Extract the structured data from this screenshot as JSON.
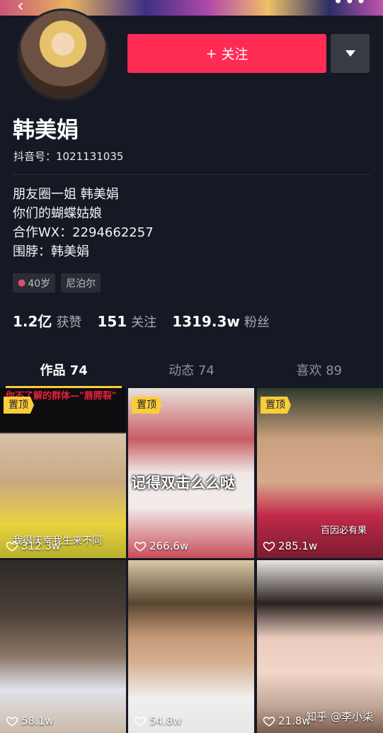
{
  "profile": {
    "name": "韩美娟",
    "douyin_id": "抖音号：1021131035",
    "follow_label": "关注",
    "bio": [
      "朋友圈一姐 韩美娟",
      "你们的蝴蝶姑娘",
      "合作WX：2294662257",
      "围脖：韩美娟"
    ],
    "tags": [
      {
        "icon": "person-icon",
        "text": "40岁"
      },
      {
        "text": "尼泊尔"
      }
    ],
    "stats": [
      {
        "num": "1.2亿",
        "label": "获赞"
      },
      {
        "num": "151",
        "label": "关注"
      },
      {
        "num": "1319.3w",
        "label": "粉丝"
      }
    ]
  },
  "tabs": [
    {
      "label": "作品 74",
      "active": true
    },
    {
      "label": "动态 74",
      "active": false
    },
    {
      "label": "喜欢 89",
      "active": false
    }
  ],
  "videos": [
    {
      "pinned": true,
      "likes": "312.3w",
      "caption": "我很庆幸我生来不同",
      "top_text": "你不了解的群体—\"唇腭裂\""
    },
    {
      "pinned": true,
      "likes": "266.6w",
      "caption": "记得双击么么哒"
    },
    {
      "pinned": true,
      "likes": "285.1w",
      "caption": "百因必有果"
    },
    {
      "pinned": false,
      "likes": "58.1w"
    },
    {
      "pinned": false,
      "likes": "54.8w"
    },
    {
      "pinned": false,
      "likes": "21.8w"
    }
  ],
  "pin_label": "置顶",
  "watermark": "知乎 @李小柒",
  "colors": {
    "background": "#161823",
    "follow": "#fe2c55",
    "pin": "#facd3b",
    "tab_indicator": "#facd3b"
  }
}
